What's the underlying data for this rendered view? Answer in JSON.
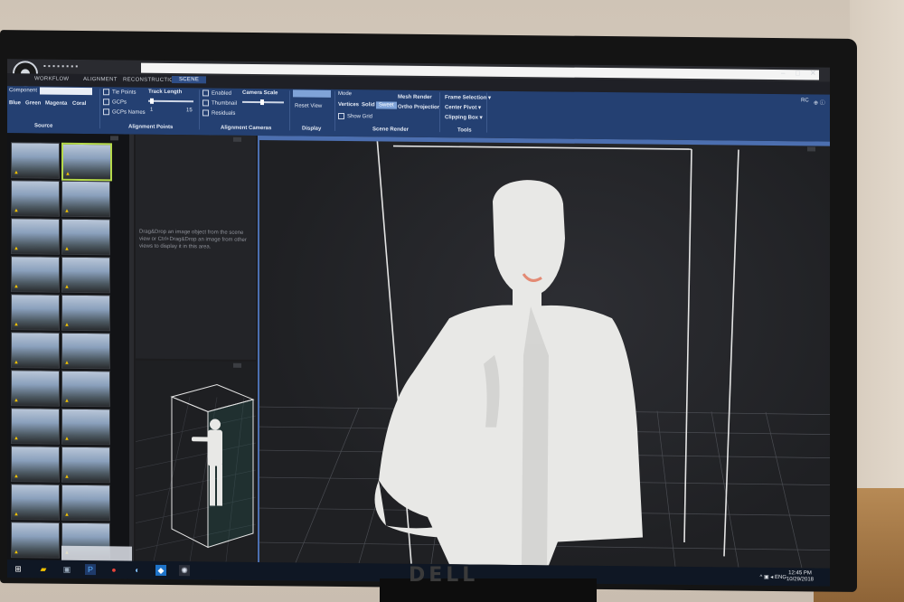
{
  "app": {
    "tabs": [
      "WORKFLOW",
      "ALIGNMENT",
      "RECONSTRUCTION",
      "SCENE"
    ],
    "active_tab": "SCENE",
    "user_initials": "RC"
  },
  "ribbon": {
    "source": {
      "label": "Component",
      "colors": [
        "Blue",
        "Green",
        "Magenta",
        "Coral"
      ],
      "group": "Source"
    },
    "alignment_points": {
      "tie_points": "Tie Points",
      "gcps": "GCPs",
      "gcps_names": "GCPs Names",
      "track_length": "Track Length",
      "min": "1",
      "max": "15",
      "group": "Alignment Points"
    },
    "alignment_cameras": {
      "enabled": "Enabled",
      "thumbnail": "Thumbnail",
      "residuals": "Residuals",
      "camera_scale": "Camera Scale",
      "group": "Alignment Cameras"
    },
    "display": {
      "reset_view": "Reset View",
      "group": "Display"
    },
    "scene_render": {
      "mode": "Mode",
      "vertices": "Vertices",
      "solid": "Solid",
      "sweet": "Sweet",
      "show_grid": "Show Grid",
      "mesh_render": "Mesh Render",
      "ortho_projection": "Ortho Projection",
      "group": "Scene Render"
    },
    "tools": {
      "frame_selection": "Frame Selection",
      "center_pivot": "Center Pivot",
      "clipping_box": "Clipping Box",
      "group": "Tools"
    }
  },
  "panels": {
    "hint": "Drag&Drop an image object from the scene view or Ctrl+Drag&Drop an image from other views to display it in this area."
  },
  "taskbar": {
    "lang": "ENG",
    "time": "12:45 PM",
    "date": "10/29/2018"
  },
  "monitor": {
    "brand": "DELL"
  },
  "colors": {
    "ribbon": "#244072",
    "accent": "#4c6fb0",
    "model": "#e8e8e6"
  }
}
